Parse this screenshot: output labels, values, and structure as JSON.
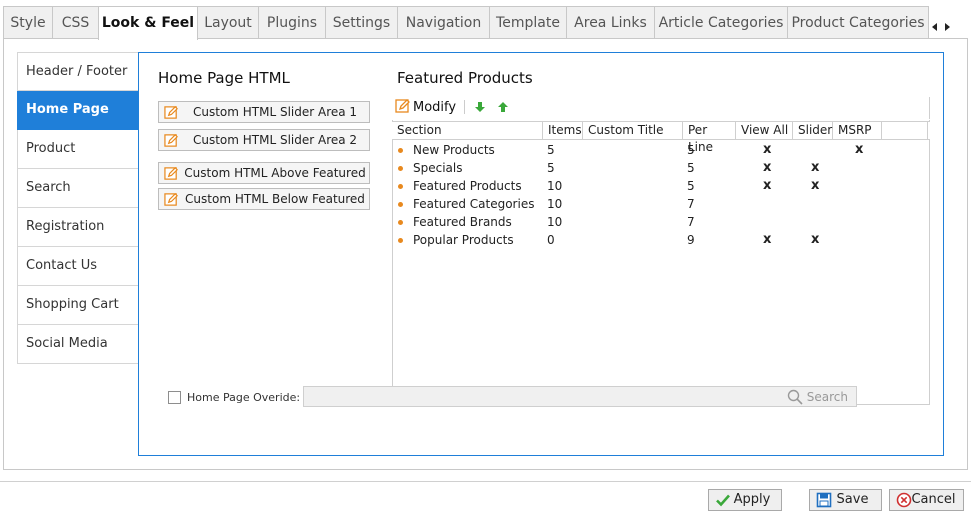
{
  "tabs": [
    "Style",
    "CSS",
    "Look & Feel",
    "Layout",
    "Plugins",
    "Settings",
    "Navigation",
    "Template",
    "Area Links",
    "Article Categories",
    "Product Categories"
  ],
  "active_tab": "Look & Feel",
  "sidebar": {
    "items": [
      "Header / Footer",
      "Home Page",
      "Product",
      "Search",
      "Registration",
      "Contact Us",
      "Shopping Cart",
      "Social Media"
    ],
    "active": "Home Page"
  },
  "home_html": {
    "title": "Home Page HTML",
    "buttons": [
      "Custom HTML Slider Area 1",
      "Custom HTML Slider Area 2",
      "Custom HTML Above Featured",
      "Custom HTML Below Featured"
    ]
  },
  "featured": {
    "title": "Featured Products",
    "modify_label": "Modify",
    "columns": [
      "Section",
      "Items",
      "Custom Title",
      "Per Line",
      "View All",
      "Slider",
      "MSRP"
    ],
    "rows": [
      {
        "section": "New Products",
        "items": "5",
        "custom_title": "",
        "per_line": "5",
        "view_all": "x",
        "slider": "",
        "msrp": "x"
      },
      {
        "section": "Specials",
        "items": "5",
        "custom_title": "",
        "per_line": "5",
        "view_all": "x",
        "slider": "x",
        "msrp": ""
      },
      {
        "section": "Featured Products",
        "items": "10",
        "custom_title": "",
        "per_line": "5",
        "view_all": "x",
        "slider": "x",
        "msrp": ""
      },
      {
        "section": "Featured Categories",
        "items": "10",
        "custom_title": "",
        "per_line": "7",
        "view_all": "",
        "slider": "",
        "msrp": ""
      },
      {
        "section": "Featured Brands",
        "items": "10",
        "custom_title": "",
        "per_line": "7",
        "view_all": "",
        "slider": "",
        "msrp": ""
      },
      {
        "section": "Popular Products",
        "items": "0",
        "custom_title": "",
        "per_line": "9",
        "view_all": "x",
        "slider": "x",
        "msrp": ""
      }
    ]
  },
  "override": {
    "label": "Home Page Overide:",
    "search_value": "",
    "search_label": "Search"
  },
  "actions": {
    "apply": "Apply",
    "save": "Save",
    "cancel": "Cancel"
  },
  "colors": {
    "accent": "#1f7fd9",
    "bullet": "#e8891e",
    "apply_icon": "#3aa83a",
    "cancel_icon": "#d03030"
  }
}
